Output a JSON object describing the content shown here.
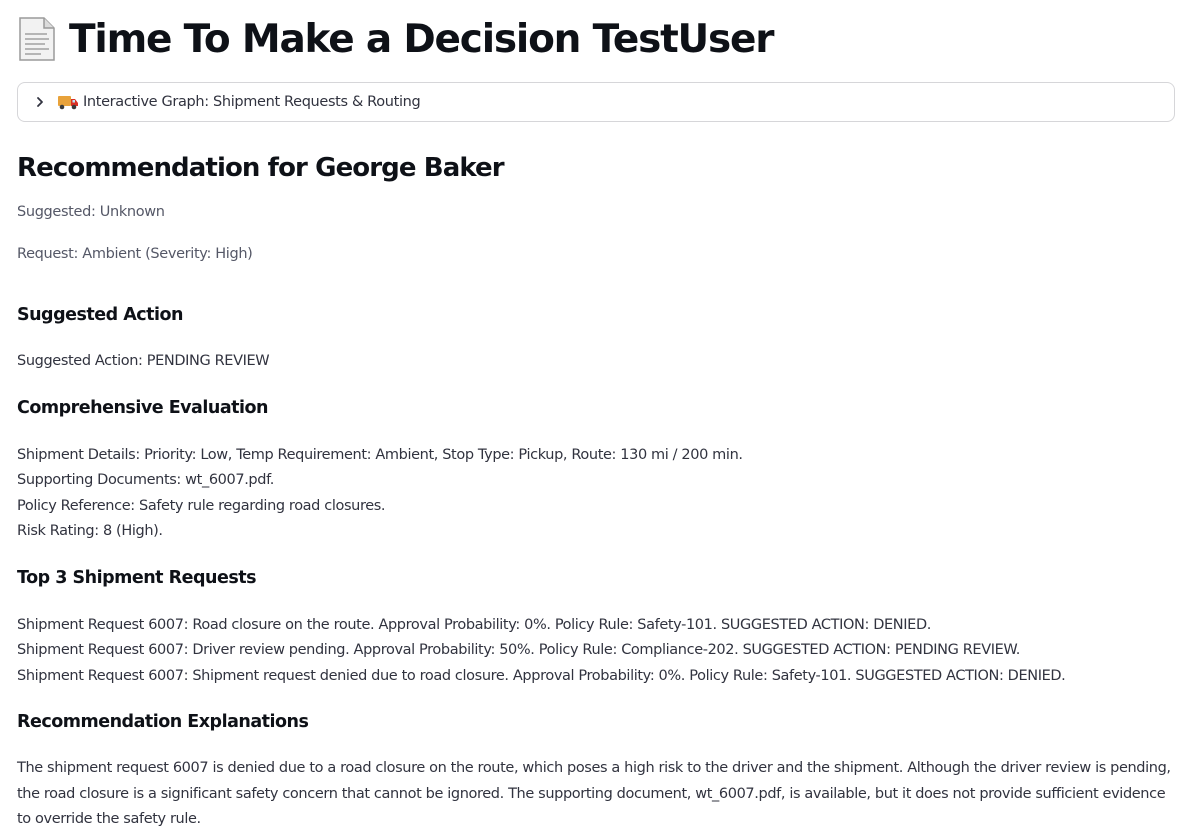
{
  "header": {
    "title": "Time To Make a Decision TestUser",
    "title_icon": "document-page-icon"
  },
  "expander": {
    "label": "Interactive Graph: Shipment Requests & Routing",
    "icon": "delivery-truck-icon",
    "expanded": false
  },
  "recommendation": {
    "heading": "Recommendation for George Baker",
    "suggested": "Suggested: Unknown",
    "request": "Request: Ambient (Severity: High)"
  },
  "suggested_action": {
    "heading": "Suggested Action",
    "text": "Suggested Action: PENDING REVIEW"
  },
  "evaluation": {
    "heading": "Comprehensive Evaluation",
    "lines": [
      "Shipment Details: Priority: Low, Temp Requirement: Ambient, Stop Type: Pickup, Route: 130 mi / 200 min.",
      "Supporting Documents: wt_6007.pdf.",
      "Policy Reference: Safety rule regarding road closures.",
      "Risk Rating: 8 (High)."
    ]
  },
  "top_requests": {
    "heading": "Top 3 Shipment Requests",
    "lines": [
      "Shipment Request 6007: Road closure on the route. Approval Probability: 0%. Policy Rule: Safety-101. SUGGESTED ACTION: DENIED.",
      "Shipment Request 6007: Driver review pending. Approval Probability: 50%. Policy Rule: Compliance-202. SUGGESTED ACTION: PENDING REVIEW.",
      "Shipment Request 6007: Shipment request denied due to road closure. Approval Probability: 0%. Policy Rule: Safety-101. SUGGESTED ACTION: DENIED."
    ]
  },
  "explanations": {
    "heading": "Recommendation Explanations",
    "text": "The shipment request 6007 is denied due to a road closure on the route, which poses a high risk to the driver and the shipment. Although the driver review is pending, the road closure is a significant safety concern that cannot be ignored. The supporting document, wt_6007.pdf, is available, but it does not provide sufficient evidence to override the safety rule."
  },
  "colors": {
    "text_primary": "#0e1117",
    "text_body": "#31333f",
    "text_muted": "#555867",
    "border": "#d6d6d9",
    "truck_cab": "#d93025",
    "truck_box": "#e8a23a"
  }
}
